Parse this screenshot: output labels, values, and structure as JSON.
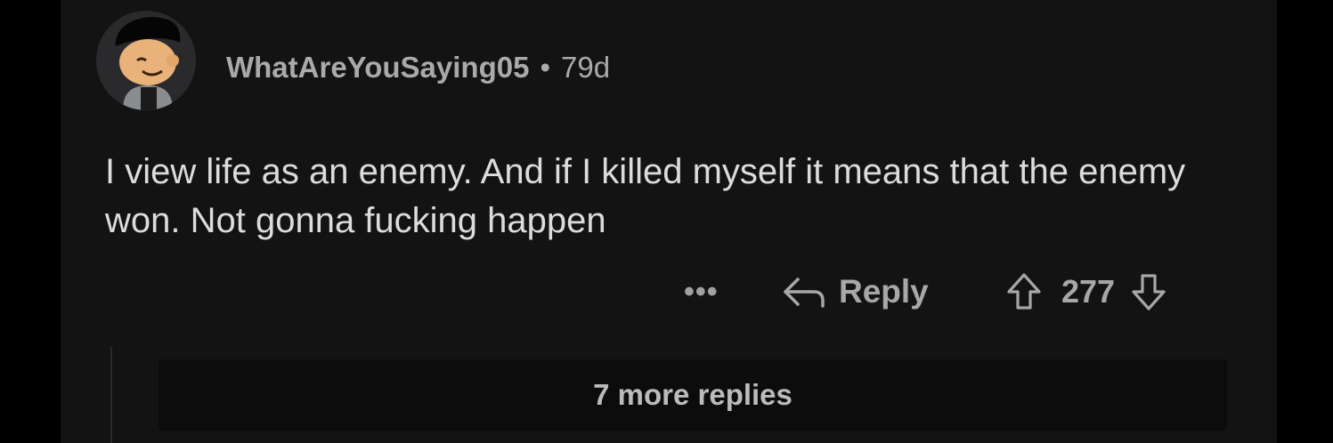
{
  "comment": {
    "author": "WhatAreYouSaying05",
    "separator": "•",
    "age": "79d",
    "body": "I view life as an enemy. And if I killed myself it means that the enemy won. Not gonna fucking happen",
    "more_label": "•••",
    "reply_label": "Reply",
    "score": "277",
    "more_replies_label": "7 more replies"
  },
  "colors": {
    "background": "#131314",
    "text": "#dcdcdc",
    "muted": "#a8aaab"
  },
  "icons": [
    "avatar",
    "reply-arrow-icon",
    "upvote-icon",
    "downvote-icon",
    "more-icon"
  ]
}
